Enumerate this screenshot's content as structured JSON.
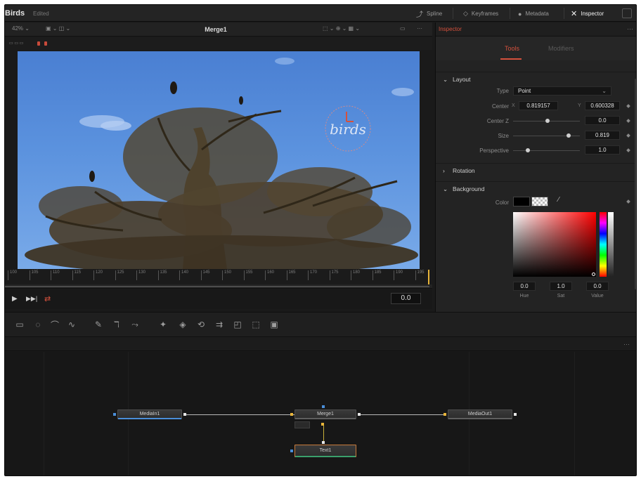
{
  "app": {
    "title": "Birds",
    "project": "Edited"
  },
  "top_nav": {
    "spline": "Spline",
    "keyframes": "Keyframes",
    "metadata": "Metadata",
    "inspector": "Inspector"
  },
  "viewer": {
    "zoom": "42%",
    "title": "Merge1",
    "ruler_ticks": [
      "100",
      "105",
      "110",
      "115",
      "120",
      "125",
      "130",
      "135",
      "140",
      "145",
      "150",
      "155",
      "160",
      "165",
      "170",
      "175",
      "180",
      "185",
      "190",
      "195"
    ],
    "timecode": "0.0"
  },
  "inspector": {
    "title": "Inspector",
    "tabs": {
      "tools": "Tools",
      "modifiers": "Modifiers"
    },
    "layout": {
      "heading": "Layout",
      "type_label": "Type",
      "type_value": "Point",
      "center_label": "Center",
      "x_label": "X",
      "center_x": "0.819157",
      "y_label": "Y",
      "center_y": "0.600328",
      "center_z_label": "Center Z",
      "center_z": "0.0",
      "size_label": "Size",
      "size": "0.819",
      "perspective_label": "Perspective",
      "perspective": "1.0"
    },
    "rotation": {
      "heading": "Rotation"
    },
    "background": {
      "heading": "Background",
      "color_label": "Color",
      "hue_value": "0.0",
      "hue_label": "Hue",
      "sat_value": "1.0",
      "sat_label": "Sat",
      "value_value": "0.0",
      "value_label": "Value"
    }
  },
  "nodes": {
    "media_in": "MediaIn1",
    "merge": "Merge1",
    "media_out": "MediaOut1",
    "text": "Text1"
  },
  "colors": {
    "accent": "#d5513d",
    "sky": "#5b92de",
    "node_out": "#e8b53a"
  }
}
